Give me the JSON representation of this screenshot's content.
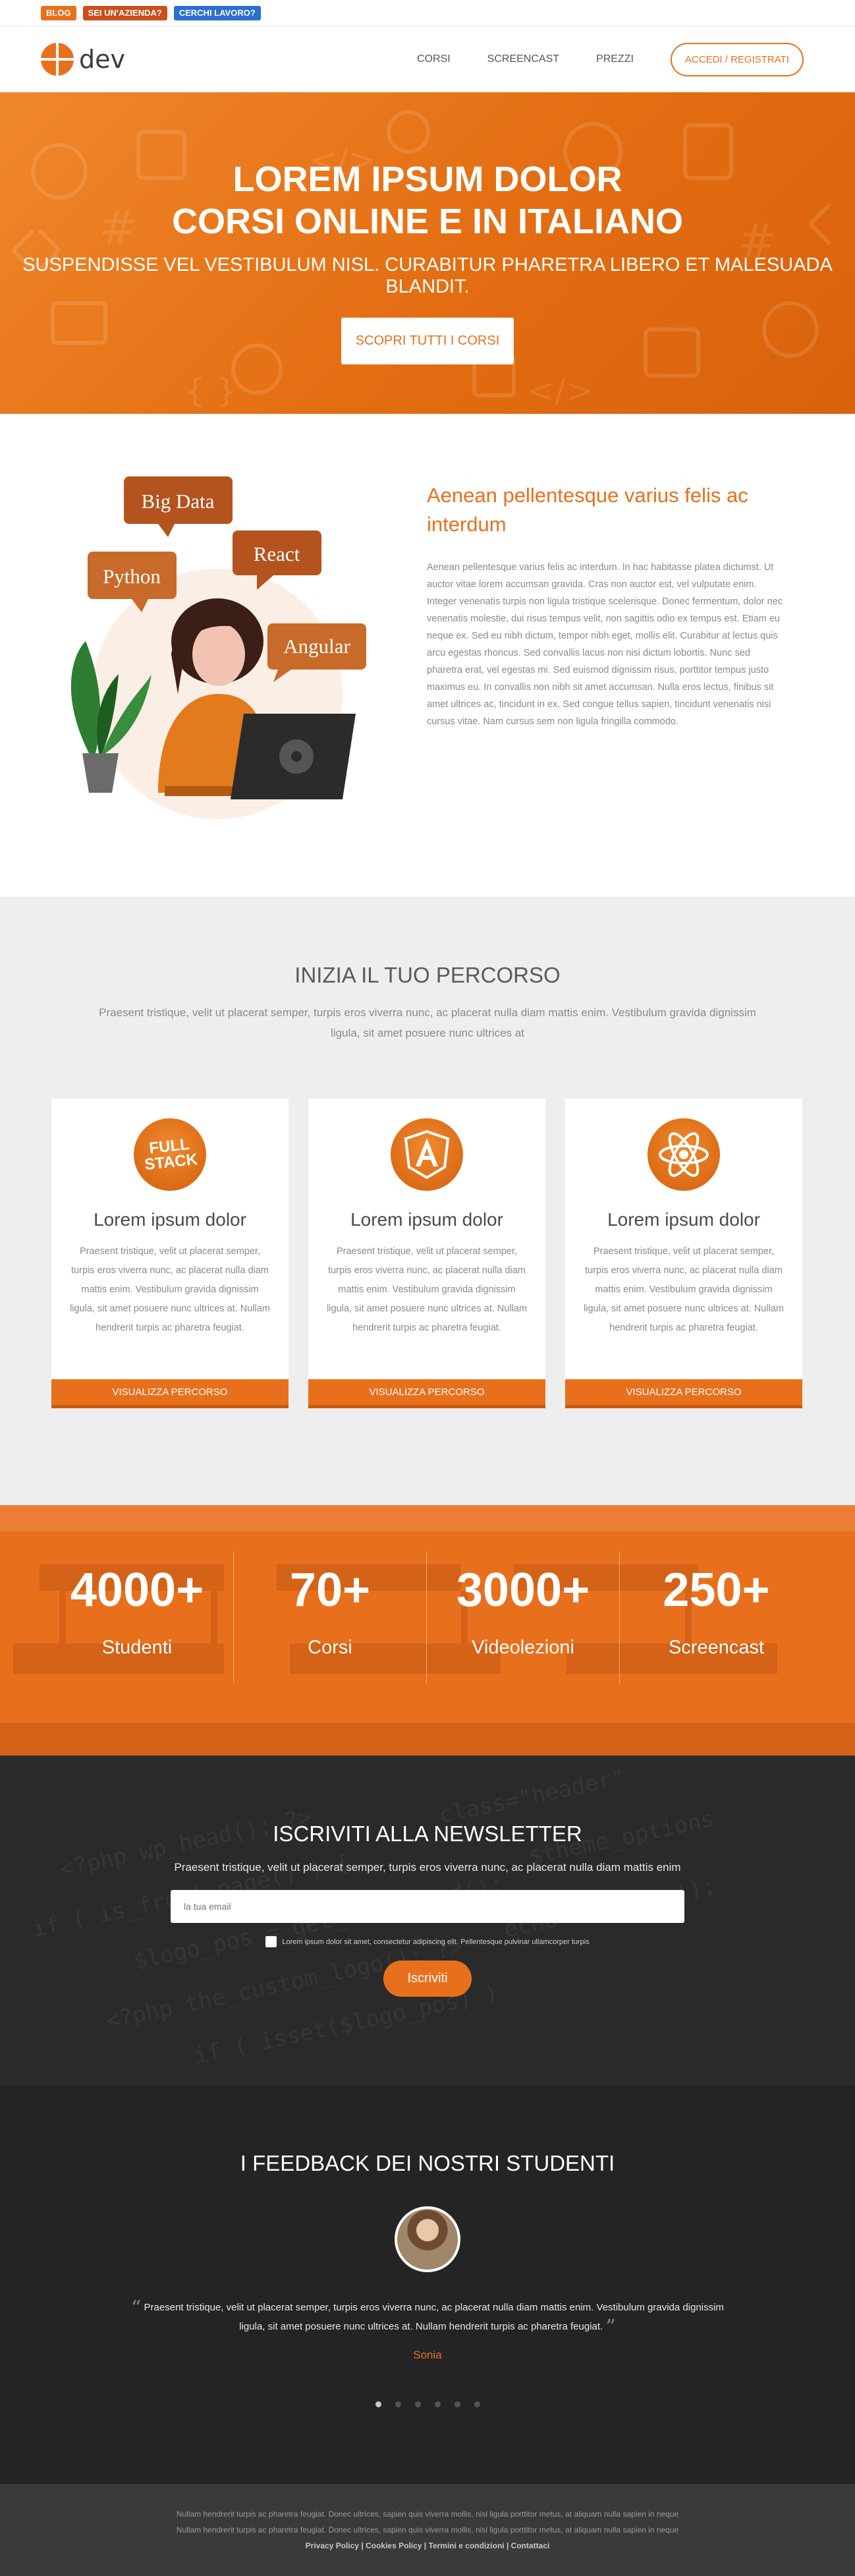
{
  "topbar": {
    "tags": [
      "BLOG",
      "SEI UN'AZIENDA?",
      "CERCHI LAVORO?"
    ]
  },
  "header": {
    "logo_text": "dev",
    "nav": [
      "CORSI",
      "SCREENCAST",
      "PREZZI"
    ],
    "cta": "ACCEDI / REGISTRATI"
  },
  "hero": {
    "title_line1": "LOREM IPSUM DOLOR",
    "title_line2": "CORSI ONLINE E IN ITALIANO",
    "subtitle": "SUSPENDISSE VEL VESTIBULUM NISL. CURABITUR PHARETRA LIBERO ET MALESUADA BLANDIT.",
    "button": "SCOPRI TUTTI I CORSI"
  },
  "about": {
    "bubbles": [
      "Big Data",
      "React",
      "Python",
      "Angular"
    ],
    "title": "Aenean pellentesque varius felis ac interdum",
    "body": "Aenean pellentesque varius felis ac interdum. In hac habitasse platea dictumst. Ut auctor vitae lorem accumsan gravida. Cras non auctor est, vel vulputate enim. Integer venenatis turpis non ligula tristique scelerisque. Donec fermentum, dolor nec venenatis molestie, dui risus tempus velit, non sagittis odio ex tempus est. Etiam eu neque ex. Sed eu nibh dictum, tempor nibh eget, mollis elit. Curabitur at lectus quis arcu egestas rhoncus. Sed convallis lacus non nisi dictum lobortis. Nunc sed pharetra erat, vel egestas mi. Sed euismod dignissim risus, porttitor tempus justo maximus eu. In convallis non nibh sit amet accumsan. Nulla eros lectus, finibus sit amet ultrices ac, tincidunt in ex. Sed congue tellus sapien, tincidunt venenatis nisi cursus vitae. Nam cursus sem non ligula fringilla commodo."
  },
  "courses": {
    "title": "INIZIA IL TUO PERCORSO",
    "subtitle": "Praesent tristique, velit ut placerat semper, turpis eros viverra nunc, ac placerat nulla diam mattis enim. Vestibulum gravida dignissim ligula, sit amet posuere nunc ultrices at",
    "cards": [
      {
        "icon": "fullstack-icon",
        "icon_text_1": "FULL",
        "icon_text_2": "STACK",
        "title": "Lorem ipsum dolor",
        "text": "Praesent tristique, velit ut placerat semper, turpis eros viverra nunc, ac placerat nulla diam mattis enim. Vestibulum gravida dignissim ligula, sit amet posuere nunc ultrices at. Nullam hendrerit turpis ac pharetra feugiat.",
        "button": "VISUALIZZA PERCORSO"
      },
      {
        "icon": "angular-icon",
        "title": "Lorem ipsum dolor",
        "text": "Praesent tristique, velit ut placerat semper, turpis eros viverra nunc, ac placerat nulla diam mattis enim. Vestibulum gravida dignissim ligula, sit amet posuere nunc ultrices at. Nullam hendrerit turpis ac pharetra feugiat.",
        "button": "VISUALIZZA PERCORSO"
      },
      {
        "icon": "react-icon",
        "title": "Lorem ipsum dolor",
        "text": "Praesent tristique, velit ut placerat semper, turpis eros viverra nunc, ac placerat nulla diam mattis enim. Vestibulum gravida dignissim ligula, sit amet posuere nunc ultrices at. Nullam hendrerit turpis ac pharetra feugiat.",
        "button": "VISUALIZZA PERCORSO"
      }
    ]
  },
  "stats": [
    {
      "value": "4000+",
      "label": "Studenti"
    },
    {
      "value": "70+",
      "label": "Corsi"
    },
    {
      "value": "3000+",
      "label": "Videolezioni"
    },
    {
      "value": "250+",
      "label": "Screencast"
    }
  ],
  "newsletter": {
    "title": "ISCRIVITI ALLA NEWSLETTER",
    "subtitle": "Praesent tristique, velit ut placerat semper, turpis eros viverra nunc, ac placerat nulla diam mattis enim",
    "placeholder": "la tua email",
    "consent": "Lorem ipsum dolor sit amet, consectetur adipiscing elit. Pellentesque pulvinar ullamcorper turpis",
    "button": "Iscriviti"
  },
  "testimonials": {
    "title": "I FEEDBACK DEI NOSTRI STUDENTI",
    "quote": "Praesent tristique, velit ut placerat semper, turpis eros viverra nunc, ac placerat nulla diam mattis enim. Vestibulum gravida dignissim ligula, sit amet posuere nunc ultrices at. Nullam hendrerit turpis ac pharetra feugiat.",
    "author": "Sonia",
    "slides": 6,
    "active_slide": 1
  },
  "footer": {
    "line1": "Nullam hendrerit turpis ac pharetra feugiat. Donec ultrices, sapien quis viverra mollis, nisl ligula porttitor metus, at aliquam nulla sapien in neque",
    "line2": "Nullam hendrerit turpis ac pharetra feugiat. Donec ultrices, sapien quis viverra mollis, nisl ligula porttitor metus, at aliquam nulla sapien in neque",
    "links": [
      "Privacy Policy",
      "Cookies Policy",
      "Termini e condizioni",
      "Contattaci"
    ],
    "separator": " | "
  },
  "colors": {
    "accent": "#e8701d",
    "dark": "#242424",
    "light_bg": "#eeeeee"
  }
}
